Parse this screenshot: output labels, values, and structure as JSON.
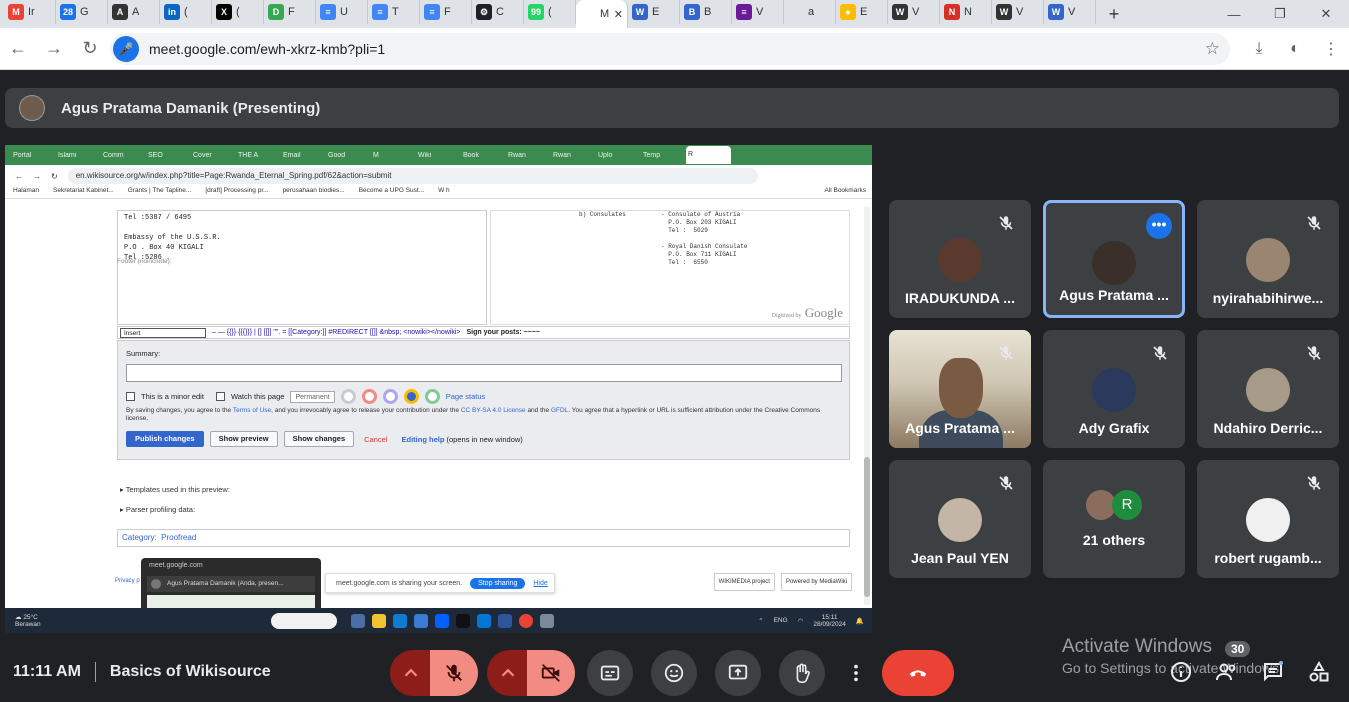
{
  "browser": {
    "tabs": [
      {
        "label": "Ir",
        "color": "#ea4335",
        "glyph": "M"
      },
      {
        "label": "G",
        "color": "#1a73e8",
        "glyph": "28"
      },
      {
        "label": "A",
        "color": "#333333",
        "glyph": "A"
      },
      {
        "label": "(",
        "color": "#0a66c2",
        "glyph": "in"
      },
      {
        "label": "(",
        "color": "#000000",
        "glyph": "X"
      },
      {
        "label": "F",
        "color": "#34a853",
        "glyph": "D"
      },
      {
        "label": "U",
        "color": "#4285f4",
        "glyph": "≡"
      },
      {
        "label": "T",
        "color": "#4285f4",
        "glyph": "≡"
      },
      {
        "label": "F",
        "color": "#4285f4",
        "glyph": "≡"
      },
      {
        "label": "C",
        "color": "#202124",
        "glyph": "⚙"
      },
      {
        "label": "(",
        "color": "#25d366",
        "glyph": "99"
      },
      {
        "label": "M",
        "color": "#ffffff",
        "glyph": "",
        "active": true
      },
      {
        "label": "E",
        "color": "#3366cc",
        "glyph": "W"
      },
      {
        "label": "B",
        "color": "#3366cc",
        "glyph": "B"
      },
      {
        "label": "V",
        "color": "#6a1b9a",
        "glyph": "≡"
      },
      {
        "label": "a",
        "color": "#dfe3e8",
        "glyph": ""
      },
      {
        "label": "E",
        "color": "#fbbc05",
        "glyph": "●"
      },
      {
        "label": "V",
        "color": "#333333",
        "glyph": "W"
      },
      {
        "label": "N",
        "color": "#d93025",
        "glyph": "N"
      },
      {
        "label": "V",
        "color": "#333333",
        "glyph": "W"
      },
      {
        "label": "V",
        "color": "#3366cc",
        "glyph": "W"
      }
    ],
    "new_tab": "+",
    "url": "meet.google.com/ewh-xkrz-kmb?pli=1"
  },
  "presenter": {
    "name": "Agus Pratama Damanik (Presenting)"
  },
  "shared_screen": {
    "tabs": [
      "Portal",
      "Islami",
      "Comm",
      "SEO",
      "Cover",
      "THE A",
      "Email",
      "Good",
      "M",
      "Wiki",
      "Book",
      "Rwan",
      "Rwan",
      "Uplo",
      "Temp",
      "R"
    ],
    "url": "en.wikisource.org/w/index.php?title=Page:Rwanda_Eternal_Spring.pdf/62&action=submit",
    "bookmarks": [
      "Halaman",
      "Sekretariat Kabinet...",
      "Grants | The Tapline...",
      "[draft] Processing pr...",
      "perusahaan biodies...",
      "Become a UPG Sust...",
      "W h"
    ],
    "bookmarks_right": "All Bookmarks",
    "editor_text": "Tel :5387 / 6495\n\nEmbassy of the U.S.S.R.\nP.O . Box 40 KIGALI\nTel :5286 .",
    "footer_note": "Footer (noinclude):",
    "scan_col1": "b) Consulates",
    "scan_col2": "- Consulate of Austria\n  P.O. Box 203 KIGALI\n  Tel :  5029",
    "scan_col3": "- Royal Danish Consulate\n  P.O. Box 711 KIGALI\n  Tel :  6550",
    "scan_digitized": "Digitized by",
    "scan_google": "Google",
    "toolbar": {
      "select": "Insert",
      "items": "– — {{}} {{{}}} | [] [[]] \"\". = [[Category:]] #REDIRECT [[]] &nbsp; <nowiki></nowiki>",
      "signature": "Sign your posts: ~~~~"
    },
    "summary_label": "Summary:",
    "minor_edit": "This is a minor edit",
    "watch_page": "Watch this page",
    "permanent": "Permanent",
    "page_status": "Page status",
    "license_text_1": "By saving changes, you agree to the ",
    "license_terms": "Terms of Use",
    "license_text_2": ", and you irrevocably agree to release your contribution under the ",
    "license_cc": "CC BY-SA 4.0 License",
    "license_text_3": " and the ",
    "license_gfdl": "GFDL",
    "license_text_4": ". You agree that a hyperlink or URL is sufficient attribution under the Creative Commons license.",
    "publish": "Publish changes",
    "preview": "Show preview",
    "show_changes": "Show changes",
    "cancel": "Cancel",
    "help_link": "Editing help",
    "help_suffix": " (opens in new window)",
    "templates": "Templates used in this preview:",
    "parser": "Parser profiling data:",
    "category_label": "Category:",
    "category_value": "Proofread",
    "privacy": "Privacy p",
    "sharing_text": "meet.google.com is sharing your screen.",
    "stop_sharing": "Stop sharing",
    "hide": "Hide",
    "wikimedia": "WIKIMEDIA project",
    "mediawiki": "Powered by MediaWiki",
    "popup_site": "meet.google.com",
    "popup_row": "Agus Pratama Damanik (Anda, presen...",
    "weather_temp": "25°C",
    "weather_desc": "Berawan",
    "lang": "ENG",
    "time": "15:11",
    "date": "28/09/2024"
  },
  "participants": [
    {
      "name": "IRADUKUNDA ...",
      "muted": true,
      "pic": "#5a3a2e"
    },
    {
      "name": "Agus Pratama ...",
      "muted": false,
      "active": true,
      "pic": "#3b2f2a"
    },
    {
      "name": "nyirahabihirwe...",
      "muted": true,
      "pic": "#9a8570"
    },
    {
      "name": "Agus Pratama ...",
      "muted": true,
      "video": true
    },
    {
      "name": "Ady Grafix",
      "muted": true,
      "pic": "#2b3a5c"
    },
    {
      "name": "Ndahiro Derric...",
      "muted": true,
      "pic": "#a89a88"
    },
    {
      "name": "Jean Paul YEN",
      "muted": true,
      "pic": "#c4b6a6"
    },
    {
      "name": "21 others",
      "others": true,
      "initial": "R"
    },
    {
      "name": "robert rugamb...",
      "muted": true,
      "pic": "#f0f0f0"
    }
  ],
  "bottom": {
    "time": "11:11 AM",
    "meeting_title": "Basics of Wikisource",
    "activate_title": "Activate Windows",
    "activate_sub": "Go to Settings to activate Windows.",
    "people_count": "30"
  },
  "colors": {
    "meet_bg": "#202124",
    "tile_bg": "#3c4043",
    "end_call": "#ea4335",
    "muted_red": "#f28b82",
    "active_border": "#8ab4f8"
  }
}
